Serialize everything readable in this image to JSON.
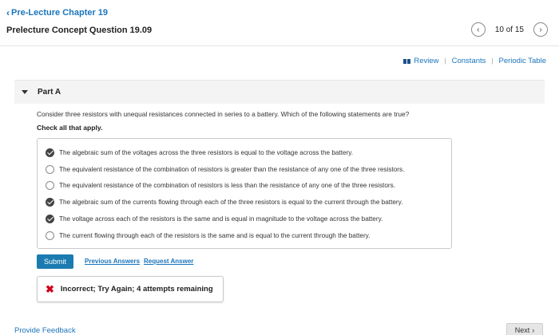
{
  "header": {
    "back_label": "Pre-Lecture Chapter 19",
    "title": "Prelecture Concept Question 19.09",
    "pager": {
      "count": "10 of 15",
      "prev_icon": "chevron-left-icon",
      "next_icon": "chevron-right-icon"
    }
  },
  "toolbar": {
    "review": "Review",
    "constants": "Constants",
    "periodic_table": "Periodic Table"
  },
  "part": {
    "label": "Part A",
    "question": "Consider three resistors with unequal resistances connected in series to a battery. Which of the following statements are true?",
    "instruction": "Check all that apply.",
    "options": [
      {
        "text": "The algebraic sum of the voltages across the three resistors is equal to the voltage across the battery.",
        "checked": true
      },
      {
        "text": "The equivalent resistance of the combination of resistors is greater than the resistance of any one of the three resistors.",
        "checked": false
      },
      {
        "text": "The equivalent resistance of the combination of resistors is less than the resistance of any one of the three resistors.",
        "checked": false
      },
      {
        "text": "The algebraic sum of the currents flowing through each of the three resistors is equal to the current through the battery.",
        "checked": true
      },
      {
        "text": "The voltage across each of the resistors is the same and is equal in magnitude to the voltage across the battery.",
        "checked": true
      },
      {
        "text": "The current flowing through each of the resistors is the same and is equal to the current through the battery.",
        "checked": false
      }
    ]
  },
  "actions": {
    "submit": "Submit",
    "previous_answers": "Previous Answers",
    "request_answer": "Request Answer"
  },
  "feedback": {
    "message": "Incorrect; Try Again; 4 attempts remaining",
    "status_color": "#d0021b"
  },
  "footer": {
    "provide_feedback": "Provide Feedback",
    "next": "Next"
  },
  "colors": {
    "accent": "#1b75bb",
    "submit_bg": "#1b7bb0"
  }
}
